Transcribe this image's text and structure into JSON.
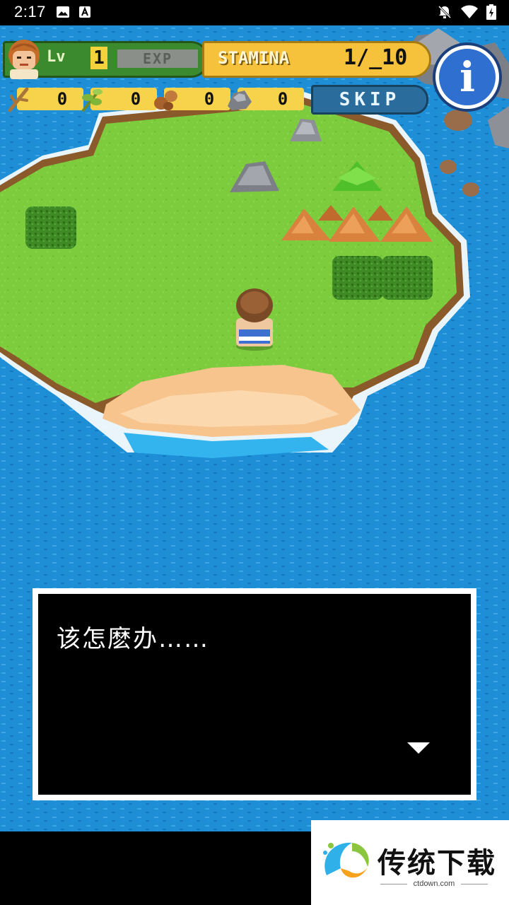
{
  "status_bar": {
    "time": "2:17",
    "left_icons": [
      "image-icon",
      "a-icon"
    ],
    "right_icons": [
      "notifications-off-icon",
      "wifi-icon",
      "battery-icon"
    ]
  },
  "hud": {
    "level_label": "Lv",
    "level_value": "1",
    "exp_label": "EXP",
    "exp_progress": 0,
    "stamina_label": "STAMINA",
    "stamina_value": "1/_10",
    "skip_label": "SKIP",
    "info_label": "i",
    "resources": [
      {
        "name": "branch",
        "count": "0"
      },
      {
        "name": "herb",
        "count": "0"
      },
      {
        "name": "nut",
        "count": "0"
      },
      {
        "name": "stone",
        "count": "0"
      }
    ]
  },
  "dialog": {
    "text": "该怎麽办……"
  },
  "watermark": {
    "title": "传统下载",
    "subtitle": "ctdown.com"
  },
  "colors": {
    "ocean": "#1e8fd6",
    "grass": "#7ccc3e",
    "sand": "#f7c48e",
    "stamina_panel": "#f6c13b",
    "level_panel": "#3c8a2e",
    "info_button": "#2f6fd0"
  }
}
